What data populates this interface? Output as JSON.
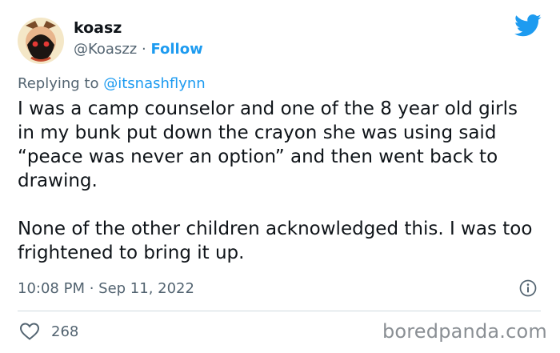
{
  "user": {
    "name": "koasz",
    "handle": "@Koaszz",
    "separator": "·",
    "follow_label": "Follow"
  },
  "reply": {
    "prefix": "Replying to",
    "target": "@itsnashflynn"
  },
  "tweet": {
    "paragraphs": [
      "I was a camp counselor and one of the 8 year old girls in my bunk put down the crayon she was using said “peace was never an option” and then went back to drawing.",
      "None of the other children acknowledged this. I was too frightened to bring it up."
    ],
    "timestamp": "10:08 PM · Sep 11, 2022"
  },
  "engagement": {
    "like_count": "268"
  },
  "watermark": "boredpanda.com",
  "colors": {
    "accent": "#1d9bf0",
    "text": "#0f1419",
    "muted": "#536471",
    "divider": "#cfd9de"
  },
  "icons": {
    "brand": "twitter-bird-icon",
    "info": "info-icon",
    "like": "heart-icon"
  }
}
